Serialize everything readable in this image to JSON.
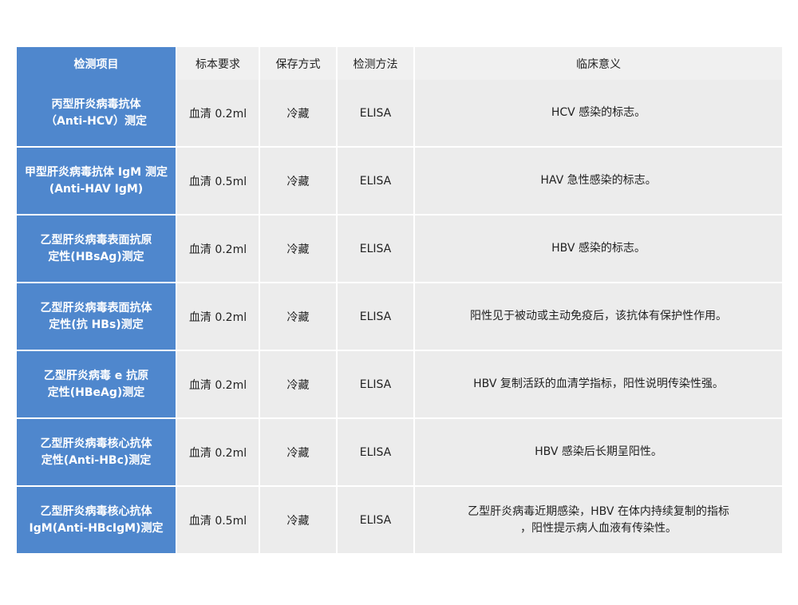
{
  "header": {
    "item": "检测项目",
    "sample": "标本要求",
    "storage": "保存方式",
    "method": "检测方法",
    "meaning": "临床意义"
  },
  "rows": [
    {
      "name_line1": "丙型肝炎病毒抗体",
      "name_line2": "（Anti-HCV）测定",
      "sample": "血清 0.2ml",
      "storage": "冷藏",
      "method": "ELISA",
      "meaning_line1": "HCV 感染的标志。",
      "meaning_line2": ""
    },
    {
      "name_line1": "甲型肝炎病毒抗体 IgM 测定",
      "name_line2": "(Anti-HAV IgM)",
      "sample": "血清 0.5ml",
      "storage": "冷藏",
      "method": "ELISA",
      "meaning_line1": "HAV 急性感染的标志。",
      "meaning_line2": ""
    },
    {
      "name_line1": "乙型肝炎病毒表面抗原",
      "name_line2": "定性(HBsAg)测定",
      "sample": "血清 0.2ml",
      "storage": "冷藏",
      "method": "ELISA",
      "meaning_line1": "HBV 感染的标志。",
      "meaning_line2": ""
    },
    {
      "name_line1": "乙型肝炎病毒表面抗体",
      "name_line2": "定性(抗 HBs)测定",
      "sample": "血清 0.2ml",
      "storage": "冷藏",
      "method": "ELISA",
      "meaning_line1": "阳性见于被动或主动免疫后，该抗体有保护性作用。",
      "meaning_line2": ""
    },
    {
      "name_line1": "乙型肝炎病毒 e 抗原",
      "name_line2": "定性(HBeAg)测定",
      "sample": "血清 0.2ml",
      "storage": "冷藏",
      "method": "ELISA",
      "meaning_line1": "HBV 复制活跃的血清学指标，阳性说明传染性强。",
      "meaning_line2": ""
    },
    {
      "name_line1": "乙型肝炎病毒核心抗体",
      "name_line2": "定性(Anti-HBc)测定",
      "sample": "血清 0.2ml",
      "storage": "冷藏",
      "method": "ELISA",
      "meaning_line1": "HBV 感染后长期呈阳性。",
      "meaning_line2": ""
    },
    {
      "name_line1": "乙型肝炎病毒核心抗体",
      "name_line2": "IgM(Anti-HBcIgM)测定",
      "sample": "血清 0.5ml",
      "storage": "冷藏",
      "method": "ELISA",
      "meaning_line1": "乙型肝炎病毒近期感染，HBV 在体内持续复制的指标",
      "meaning_line2": "，阳性提示病人血液有传染性。"
    }
  ]
}
